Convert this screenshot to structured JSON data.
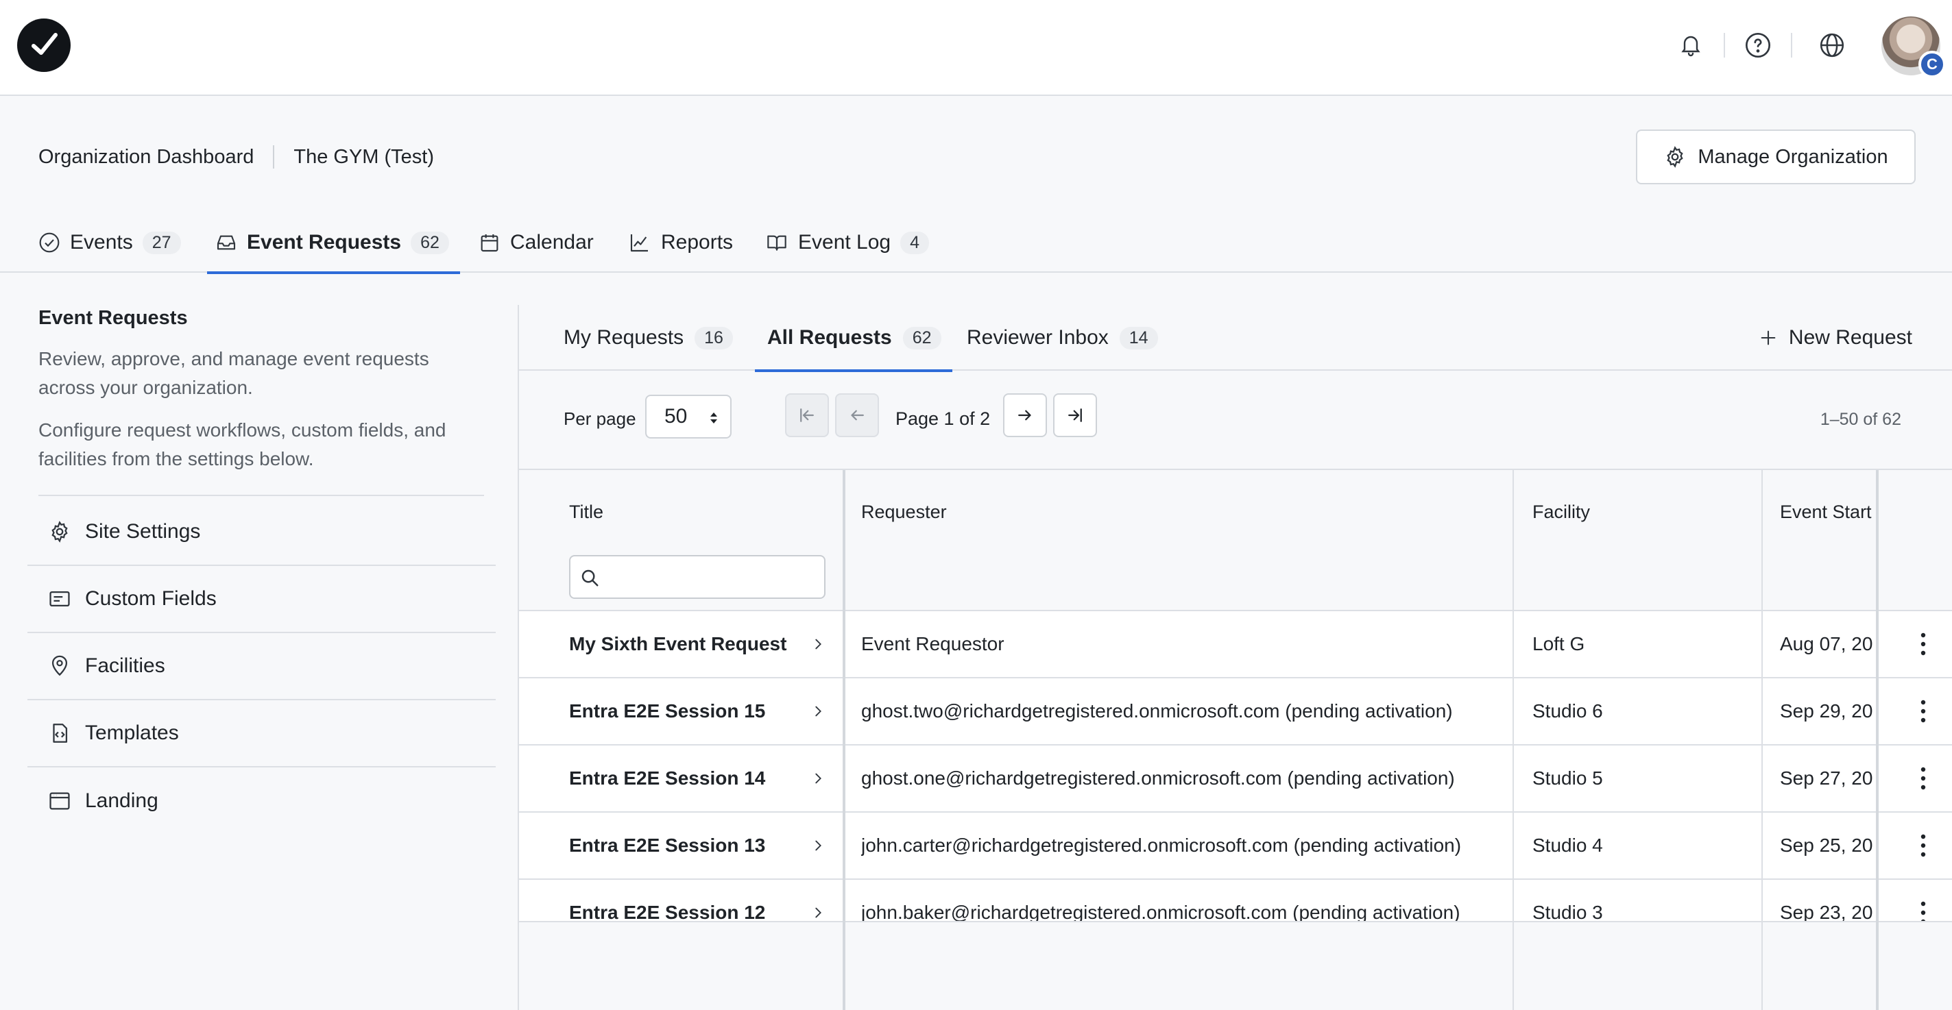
{
  "topbar": {
    "logo": "checkmark-logo-icon",
    "icons": [
      "bell-icon",
      "help-circle-icon",
      "globe-icon"
    ],
    "avatar_badge": "C"
  },
  "header": {
    "breadcrumb_root": "Organization Dashboard",
    "breadcrumb_org": "The GYM (Test)",
    "manage_label": "Manage Organization"
  },
  "main_tabs": [
    {
      "label": "Events",
      "count": "27",
      "icon": "check-circle-icon"
    },
    {
      "label": "Event Requests",
      "count": "62",
      "icon": "inbox-icon",
      "active": true
    },
    {
      "label": "Calendar",
      "icon": "calendar-icon"
    },
    {
      "label": "Reports",
      "icon": "line-chart-icon"
    },
    {
      "label": "Event Log",
      "count": "4",
      "icon": "book-icon"
    }
  ],
  "left_panel": {
    "title": "Event Requests",
    "desc1": "Review, approve, and manage event requests across your organization.",
    "desc2": "Configure request workflows, custom fields, and facilities from the settings below.",
    "items": [
      {
        "label": "Site Settings",
        "icon": "gear-icon"
      },
      {
        "label": "Custom Fields",
        "icon": "form-field-icon"
      },
      {
        "label": "Facilities",
        "icon": "map-pin-icon"
      },
      {
        "label": "Templates",
        "icon": "file-code-icon"
      },
      {
        "label": "Landing",
        "icon": "browser-window-icon"
      }
    ]
  },
  "sub_tabs": [
    {
      "label": "My Requests",
      "count": "16"
    },
    {
      "label": "All Requests",
      "count": "62",
      "active": true
    },
    {
      "label": "Reviewer Inbox",
      "count": "14"
    }
  ],
  "new_request_label": "New Request",
  "pager": {
    "per_page_label": "Per page",
    "per_page_value": "50",
    "page_text": "Page 1 of 2",
    "range_text": "1–50 of 62"
  },
  "table": {
    "columns": [
      "Title",
      "Requester",
      "Facility",
      "Event Start"
    ],
    "rows": [
      {
        "title": "My Sixth Event Request",
        "requester": "Event Requestor",
        "facility": "Loft G",
        "start": "Aug 07, 20"
      },
      {
        "title": "Entra E2E Session 15",
        "requester": "ghost.two@richardgetregistered.onmicrosoft.com (pending activation)",
        "facility": "Studio 6",
        "start": "Sep 29, 20"
      },
      {
        "title": "Entra E2E Session 14",
        "requester": "ghost.one@richardgetregistered.onmicrosoft.com (pending activation)",
        "facility": "Studio 5",
        "start": "Sep 27, 20"
      },
      {
        "title": "Entra E2E Session 13",
        "requester": "john.carter@richardgetregistered.onmicrosoft.com (pending activation)",
        "facility": "Studio 4",
        "start": "Sep 25, 20"
      },
      {
        "title": "Entra E2E Session 12",
        "requester": "john.baker@richardgetregistered.onmicrosoft.com (pending activation)",
        "facility": "Studio 3",
        "start": "Sep 23, 20"
      }
    ]
  },
  "colors": {
    "accent": "#2e6bd8",
    "border": "#dcdfe4",
    "muted_text": "#5b6168"
  }
}
